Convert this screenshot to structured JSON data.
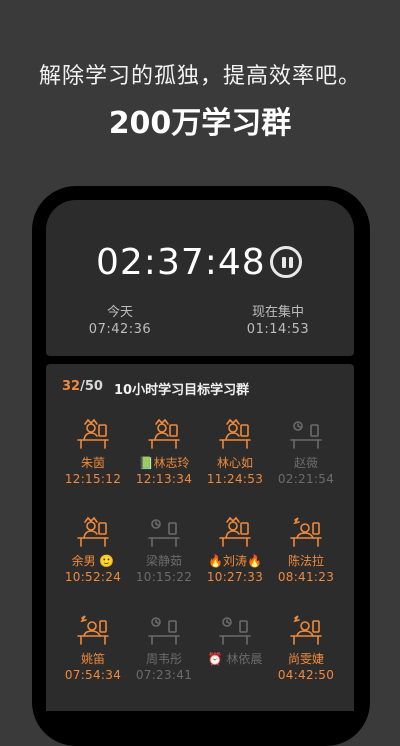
{
  "promo": {
    "headline": "解除学习的孤独，提高效率吧。",
    "subheadline": "200万学习群"
  },
  "timer": {
    "value": "02:37:48",
    "today_label": "今天",
    "today_value": "07:42:36",
    "focus_label": "现在集中",
    "focus_value": "01:14:53"
  },
  "group": {
    "current": "32",
    "total": "/50",
    "name": "10小时学习目标学习群"
  },
  "colors": {
    "accent": "#f08a3c",
    "idle": "#6b6b6b",
    "panel": "#2c2c2c",
    "background": "#3a3a3a"
  },
  "members": [
    {
      "name": "朱茵",
      "time": "12:15:12",
      "status": "studying",
      "icon": "studying-person-icon"
    },
    {
      "name": "📗林志玲",
      "time": "12:13:34",
      "status": "studying",
      "icon": "studying-person-icon"
    },
    {
      "name": "林心如",
      "time": "11:24:53",
      "status": "studying",
      "icon": "studying-person-icon"
    },
    {
      "name": "赵薇",
      "time": "02:21:54",
      "status": "away",
      "icon": "empty-desk-icon"
    },
    {
      "name": "余男 🙂",
      "time": "10:52:24",
      "status": "studying",
      "icon": "studying-person-icon"
    },
    {
      "name": "梁静茹",
      "time": "10:15:22",
      "status": "away",
      "icon": "empty-desk-icon"
    },
    {
      "name": "🔥刘涛🔥",
      "time": "10:27:33",
      "status": "studying",
      "icon": "studying-person-icon"
    },
    {
      "name": "陈法拉",
      "time": "08:41:23",
      "status": "sleeping",
      "icon": "sleeping-person-icon"
    },
    {
      "name": "姚笛",
      "time": "07:54:34",
      "status": "sleeping",
      "icon": "sleeping-person-icon"
    },
    {
      "name": "周韦彤",
      "time": "07:23:41",
      "status": "away",
      "icon": "empty-desk-icon"
    },
    {
      "name": "⏰ 林依晨",
      "time": "",
      "status": "away",
      "icon": "empty-desk-icon"
    },
    {
      "name": "尚雯婕",
      "time": "04:42:50",
      "status": "sleeping",
      "icon": "sleeping-person-icon"
    }
  ]
}
